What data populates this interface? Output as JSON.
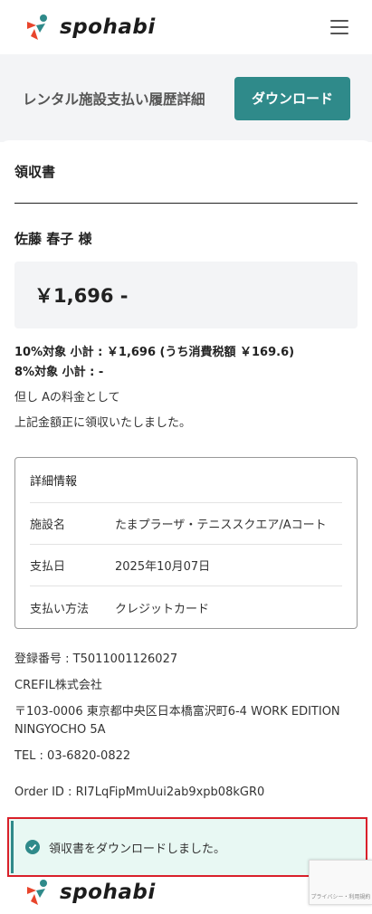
{
  "header": {
    "logo_text": "spohabi",
    "menu_icon": "hamburger-menu-icon"
  },
  "title_bar": {
    "title": "レンタル施設支払い履歴詳細",
    "download_label": "ダウンロード"
  },
  "receipt": {
    "heading": "領収書",
    "recipient": "佐藤 春子 様",
    "amount": "￥1,696 -",
    "tax_10": "10%対象 小計 : ￥1,696 (うち消費税額 ￥169.6)",
    "tax_8": "8%対象 小計 : -",
    "note": "但し Aの料金として",
    "confirmation": "上記金額正に領収いたしました。"
  },
  "details": {
    "title": "詳細情報",
    "rows": [
      {
        "key": "施設名",
        "value": "たまプラーザ・テニススクエア/Aコート"
      },
      {
        "key": "支払日",
        "value": "2025年10月07日"
      },
      {
        "key": "支払い方法",
        "value": "クレジットカード"
      }
    ]
  },
  "company": {
    "registration": "登録番号 : T5011001126027",
    "name": "CREFIL株式会社",
    "address": "〒103-0006 東京都中央区日本橋富沢町6-4 WORK EDITION NINGYOCHO 5A",
    "tel": "TEL : 03-6820-0822"
  },
  "order_id": "Order ID : RI7LqFipMmUui2ab9xpb08kGR0",
  "toast": {
    "message": "領収書をダウンロードしました。",
    "icon": "check-circle-icon"
  },
  "footer": {
    "logo_text": "spohabi"
  },
  "recaptcha": {
    "text": "プライバシー・利用規約"
  },
  "colors": {
    "accent": "#2f8a8a",
    "toast_bg": "#e8f8f3",
    "highlight_border": "#d9202a"
  }
}
